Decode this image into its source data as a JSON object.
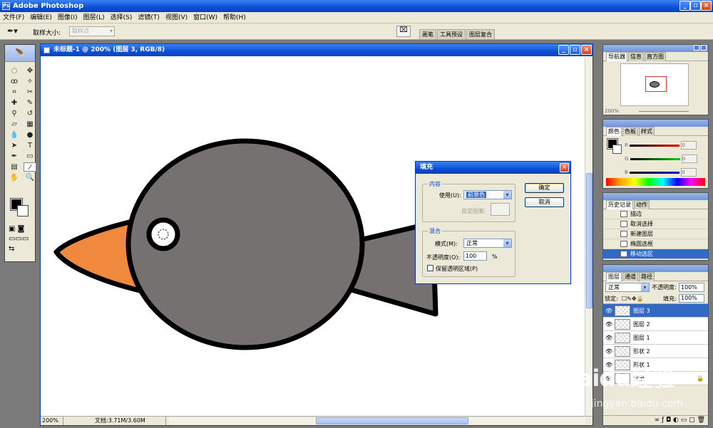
{
  "app": {
    "title": "Adobe Photoshop"
  },
  "menu": [
    "文件(F)",
    "编辑(E)",
    "图像(I)",
    "图层(L)",
    "选择(S)",
    "滤镜(T)",
    "视图(V)",
    "窗口(W)",
    "帮助(H)"
  ],
  "options": {
    "sample_size_label": "取样大小:",
    "sample_size_value": "取样点"
  },
  "palette_well": {
    "tabs": [
      "画笔",
      "工具预设",
      "图层复合"
    ]
  },
  "document": {
    "title": "未标题-1 @ 200% (图层 3, RGB/8)",
    "zoom": "200%",
    "doc_info": "文档:3.71M/3.60M"
  },
  "colors": {
    "foreground": "#000000",
    "background": "#ffffff",
    "bird_body": "#757171",
    "beak": "#f0883e",
    "outline": "#000000"
  },
  "fill_dialog": {
    "title": "填充",
    "content_group": "内容",
    "use_label": "使用(U):",
    "use_value": "前景色",
    "custom_pattern_label": "自定图案:",
    "blend_group": "混合",
    "mode_label": "模式(M):",
    "mode_value": "正常",
    "opacity_label": "不透明度(O):",
    "opacity_value": "100",
    "opacity_unit": "%",
    "preserve_label": "保留透明区域(P)",
    "ok": "确定",
    "cancel": "取消"
  },
  "navigator": {
    "tabs": [
      "导航器",
      "信息",
      "直方图"
    ],
    "zoom": "200%"
  },
  "color_panel": {
    "tabs": [
      "颜色",
      "色板",
      "样式"
    ],
    "channels": [
      "R",
      "G",
      "B"
    ],
    "values": [
      "0",
      "0",
      "0"
    ]
  },
  "history": {
    "tabs": [
      "历史记录",
      "动作"
    ],
    "items": [
      "描边",
      "取消选择",
      "新建图层",
      "椭圆选框",
      "移动选区"
    ],
    "selected": 4
  },
  "layers": {
    "tabs": [
      "图层",
      "通道",
      "路径"
    ],
    "blend": "正常",
    "opacity_label": "不透明度:",
    "opacity": "100%",
    "lock_label": "锁定:",
    "fill_label": "填充:",
    "fill": "100%",
    "items": [
      "图层 3",
      "图层 2",
      "图层 1",
      "形状 2",
      "形状 1",
      "背景"
    ],
    "selected": 0
  },
  "watermark": {
    "brand": "Baidu经验",
    "url": "jingyan.baidu.com"
  }
}
